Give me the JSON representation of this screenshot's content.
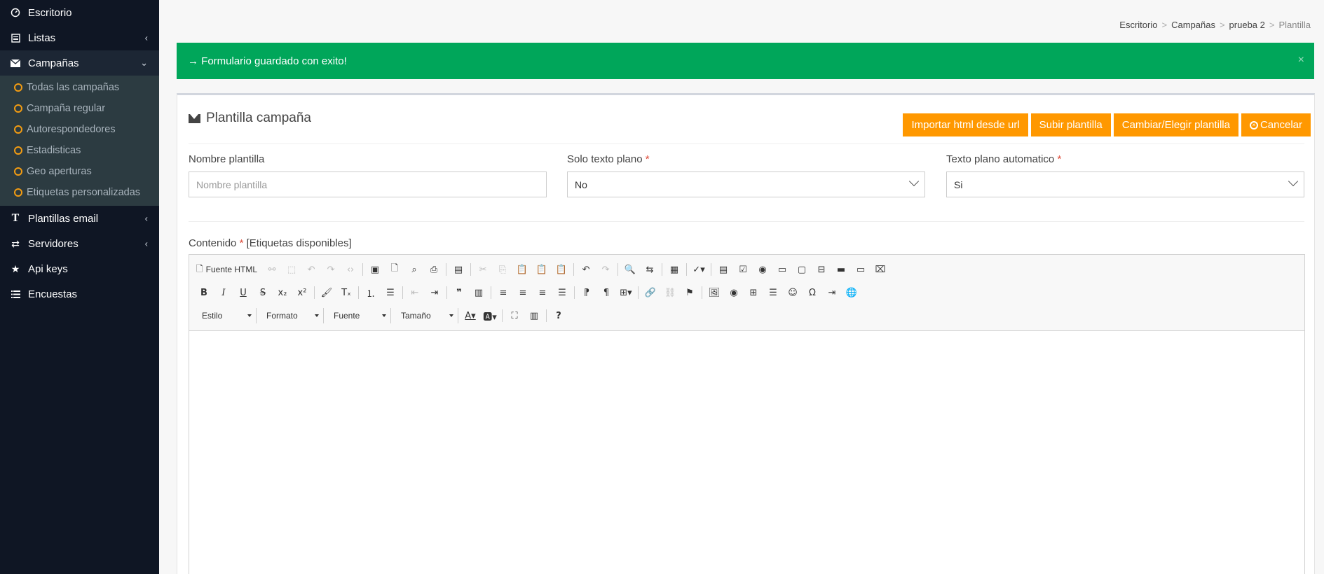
{
  "sidebar": {
    "items": [
      {
        "label": "Escritorio",
        "icon": "dashboard-icon"
      },
      {
        "label": "Listas",
        "icon": "list-icon"
      },
      {
        "label": "Campañas",
        "icon": "envelope-icon"
      },
      {
        "label": "Plantillas email",
        "icon": "text-icon"
      },
      {
        "label": "Servidores",
        "icon": "exchange-icon"
      },
      {
        "label": "Api keys",
        "icon": "star-icon"
      },
      {
        "label": "Encuestas",
        "icon": "bars-icon"
      }
    ],
    "submenu": [
      "Todas las campañas",
      "Campaña regular",
      "Autorespondedores",
      "Estadisticas",
      "Geo aperturas",
      "Etiquetas personalizadas"
    ]
  },
  "breadcrumb": [
    "Escritorio",
    "Campañas",
    "prueba 2",
    "Plantilla"
  ],
  "alert": {
    "text": "→ Formulario guardado con exito!",
    "close": "×"
  },
  "box": {
    "title": "Plantilla campaña",
    "buttons": {
      "import": "Importar html desde url",
      "upload": "Subir plantilla",
      "change": "Cambiar/Elegir plantilla",
      "cancel": "Cancelar"
    }
  },
  "form": {
    "name_label": "Nombre plantilla",
    "name_placeholder": "Nombre plantilla",
    "plain_label": "Solo texto plano",
    "plain_value": "No",
    "auto_label": "Texto plano automatico",
    "auto_value": "Si",
    "required_mark": "*",
    "content_label": "Contenido",
    "content_tags": "[Etiquetas disponibles]"
  },
  "editor": {
    "source_label": "Fuente HTML",
    "combos": {
      "style": "Estilo",
      "format": "Formato",
      "font": "Fuente",
      "size": "Tamaño"
    }
  },
  "colors": {
    "sidebar_bg": "#0f1624",
    "submenu_bg": "#2c3b41",
    "alert_green": "#00a65a",
    "button_orange": "#ff9800",
    "required_red": "#dd4b39"
  }
}
